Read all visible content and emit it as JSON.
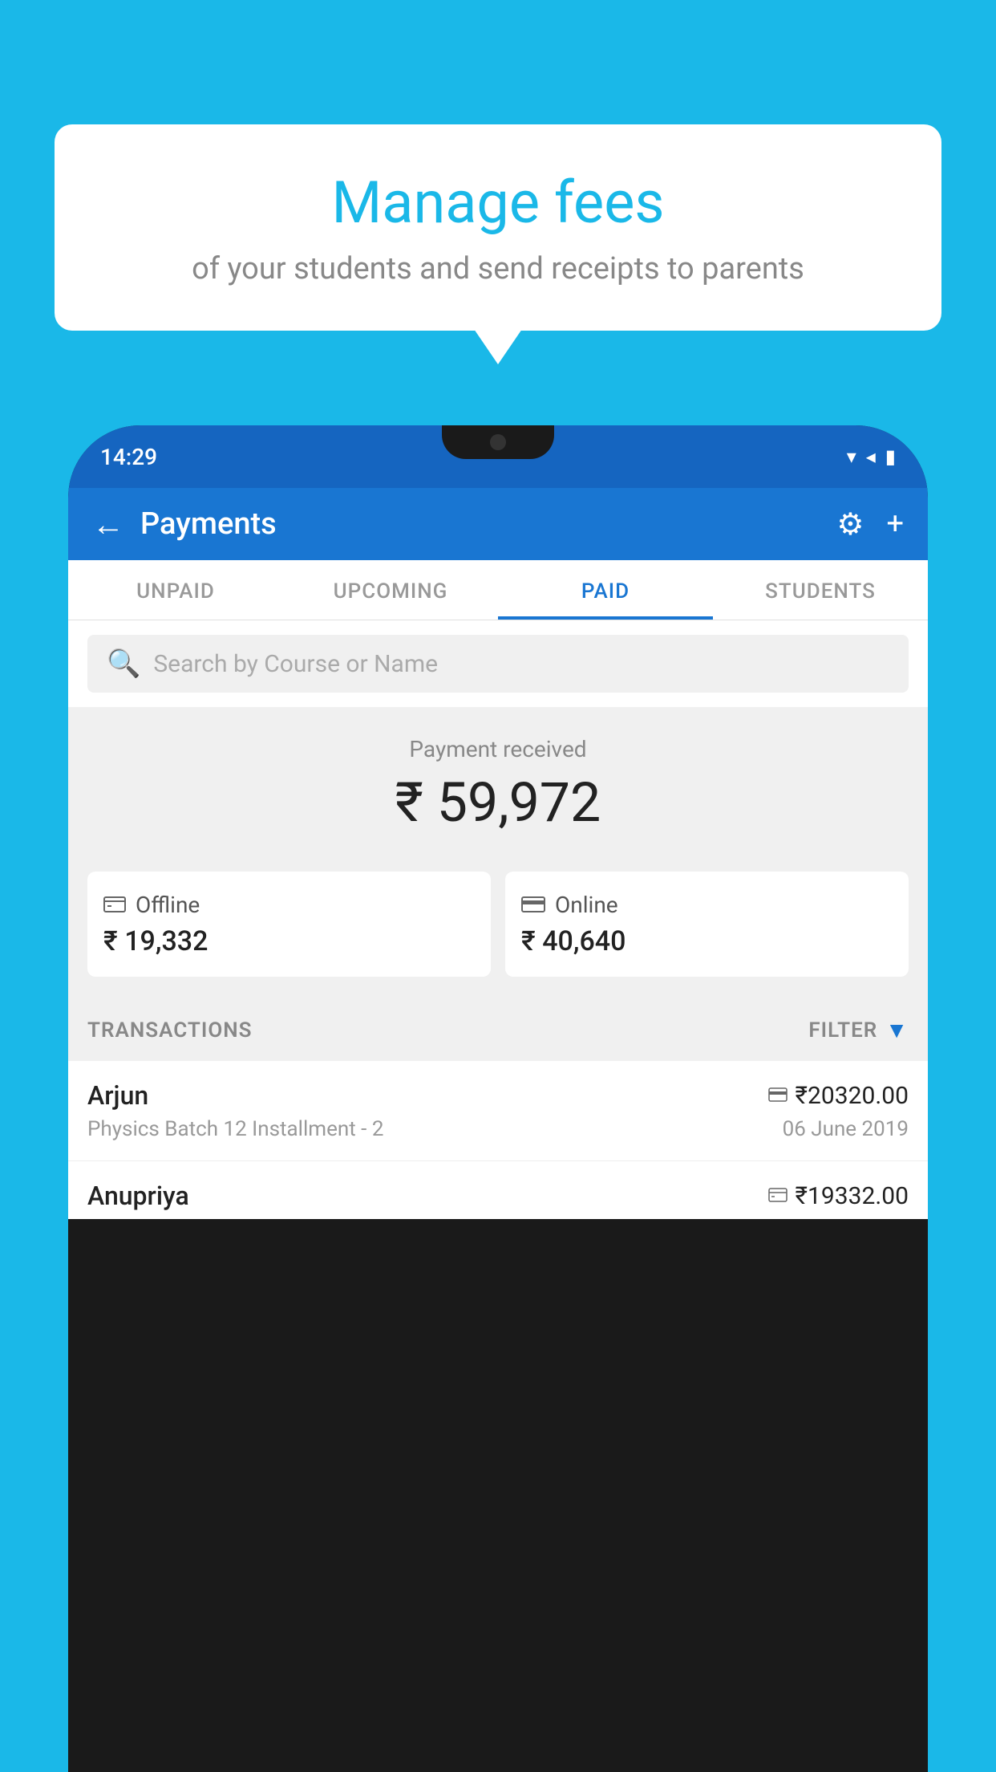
{
  "background_color": "#1ab8e8",
  "speech_bubble": {
    "title": "Manage fees",
    "subtitle": "of your students and send receipts to parents"
  },
  "phone": {
    "status_bar": {
      "time": "14:29",
      "wifi": "▼",
      "signal": "▲",
      "battery": "▮"
    },
    "header": {
      "title": "Payments",
      "back_label": "←",
      "gear_label": "⚙",
      "plus_label": "+"
    },
    "tabs": [
      {
        "label": "UNPAID",
        "active": false
      },
      {
        "label": "UPCOMING",
        "active": false
      },
      {
        "label": "PAID",
        "active": true
      },
      {
        "label": "STUDENTS",
        "active": false
      }
    ],
    "search": {
      "placeholder": "Search by Course or Name"
    },
    "payment_received": {
      "label": "Payment received",
      "amount": "₹ 59,972"
    },
    "payment_cards": [
      {
        "icon": "offline-payment-icon",
        "icon_char": "▣",
        "label": "Offline",
        "amount": "₹ 19,332"
      },
      {
        "icon": "online-payment-icon",
        "icon_char": "▬",
        "label": "Online",
        "amount": "₹ 40,640"
      }
    ],
    "transactions": {
      "header_label": "TRANSACTIONS",
      "filter_label": "FILTER",
      "filter_icon": "▼",
      "rows": [
        {
          "name": "Arjun",
          "payment_icon": "card-icon",
          "payment_icon_char": "▬",
          "amount": "₹20320.00",
          "detail": "Physics Batch 12 Installment - 2",
          "date": "06 June 2019"
        },
        {
          "name": "Anupriya",
          "payment_icon": "offline-icon",
          "payment_icon_char": "▣",
          "amount": "₹19332.00",
          "detail": "",
          "date": ""
        }
      ]
    }
  }
}
